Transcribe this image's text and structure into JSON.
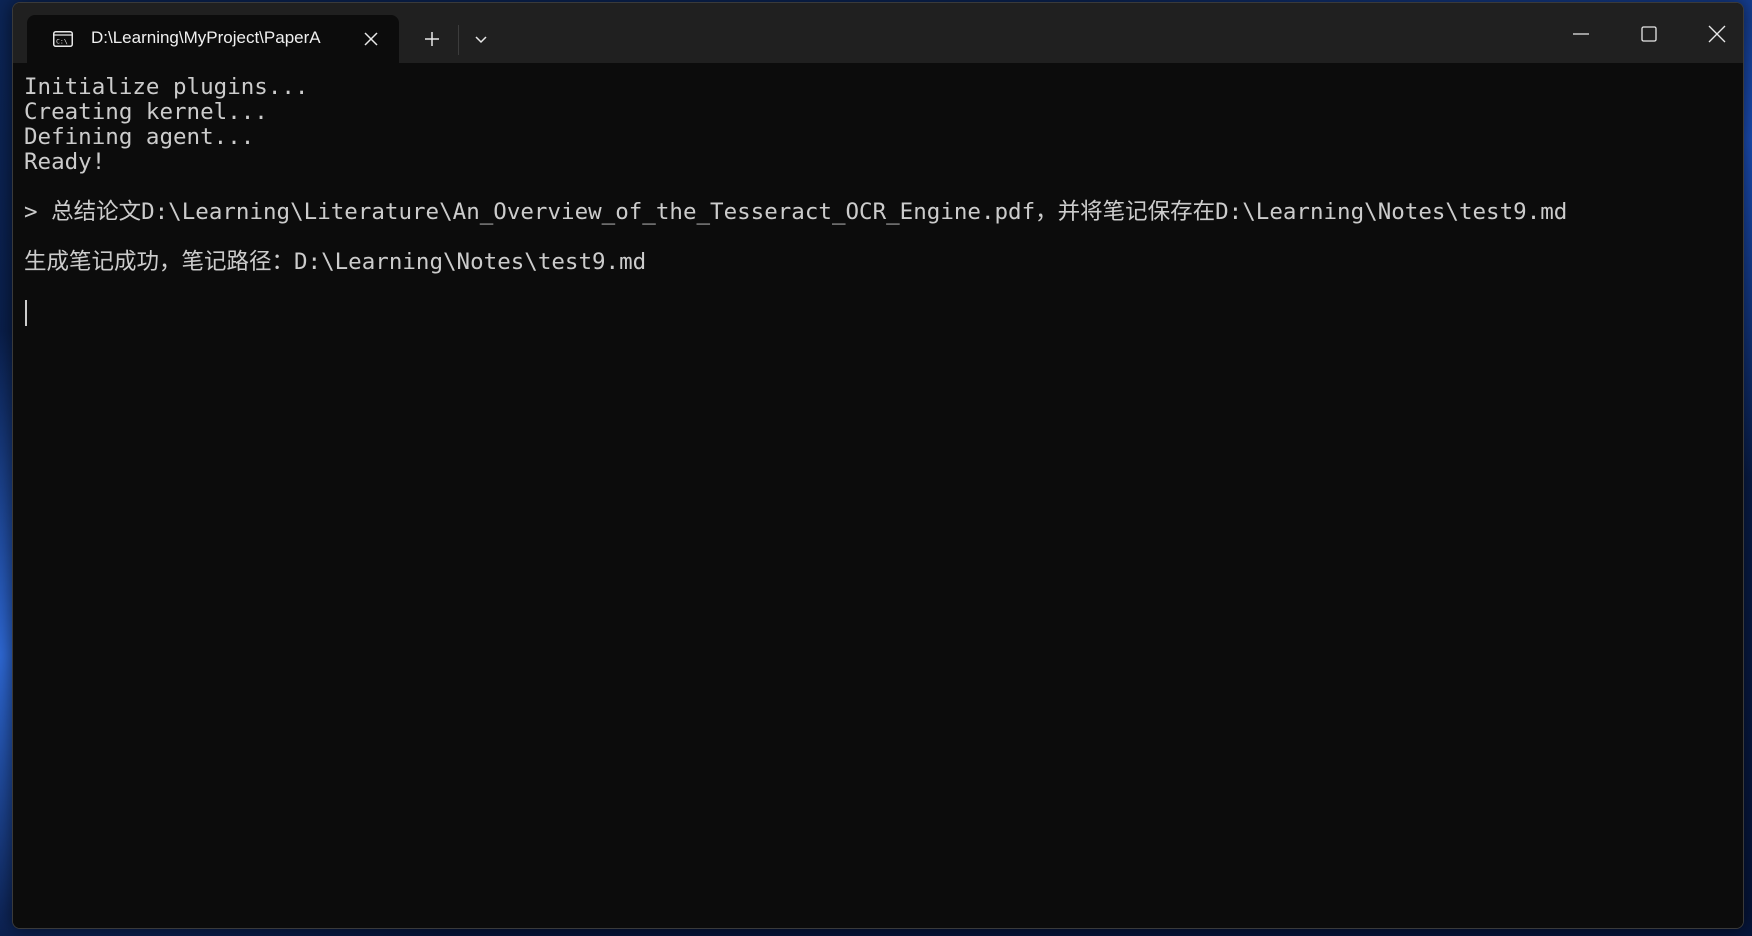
{
  "tab": {
    "title": "D:\\Learning\\MyProject\\PaperA",
    "icon": "terminal-icon"
  },
  "titlebar": {
    "new_tab_icon": "plus-icon",
    "dropdown_icon": "chevron-down-icon",
    "minimize_icon": "minimize-icon",
    "maximize_icon": "maximize-icon",
    "close_icon": "close-icon"
  },
  "terminal": {
    "lines": [
      "Initialize plugins...",
      "Creating kernel...",
      "Defining agent...",
      "Ready!",
      "",
      "> 总结论文D:\\Learning\\Literature\\An_Overview_of_the_Tesseract_OCR_Engine.pdf，并将笔记保存在D:\\Learning\\Notes\\test9.md",
      "",
      "生成笔记成功，笔记路径：D:\\Learning\\Notes\\test9.md"
    ]
  },
  "colors": {
    "terminal_bg": "#0c0c0c",
    "titlebar_bg": "#202020",
    "text": "#cccccc"
  }
}
